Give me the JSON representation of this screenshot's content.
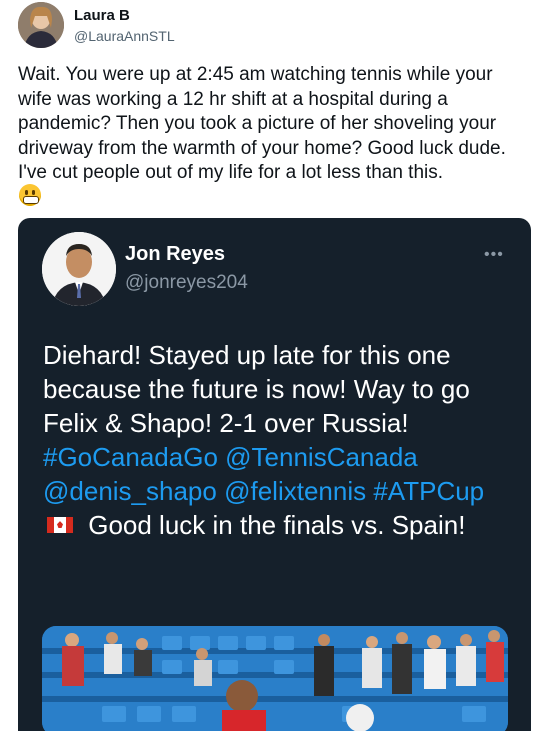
{
  "tweet": {
    "author_name": "Laura B",
    "author_handle": "@LauraAnnSTL",
    "text": "Wait. You were up at 2:45 am watching tennis while your wife was working a 12 hr shift at a hospital during a pandemic? Then you took a picture of her shoveling your driveway from the warmth of your home? Good luck dude. I've cut people out of my life for a lot less than this.",
    "emoji_icon": "grimacing-face-icon"
  },
  "quoted": {
    "author_name": "Jon Reyes",
    "author_handle": "@jonreyes204",
    "more_label": "•••",
    "text_1": "Diehard! Stayed up late for this one because the future is now! Way to go Felix & Shapo! 2-1 over Russia! ",
    "hashtag_1": "#GoCanadaGo",
    "mention_1": "@TennisCanada",
    "mention_2": "@denis_shapo",
    "mention_3": "@felixtennis",
    "hashtag_2": "#ATPCup",
    "flag_icon": "canada-flag-icon",
    "text_2": " Good luck in the finals vs. Spain!"
  },
  "colors": {
    "link": "#1d9bf0",
    "card_bg": "#15202b"
  }
}
